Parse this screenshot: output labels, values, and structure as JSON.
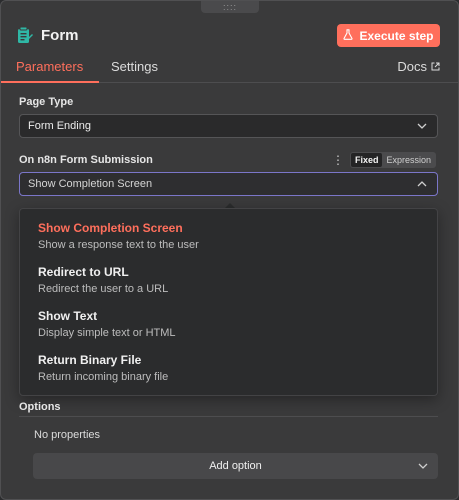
{
  "node": {
    "title": "Form",
    "icon": "form-icon",
    "execute_label": "Execute step",
    "execute_icon": "flask-icon",
    "accent_color": "#ff6f5c"
  },
  "tabs": [
    {
      "label": "Parameters",
      "active": true
    },
    {
      "label": "Settings",
      "active": false
    }
  ],
  "docs": {
    "label": "Docs",
    "icon": "external-link-icon"
  },
  "page_type": {
    "label": "Page Type",
    "value": "Form Ending"
  },
  "on_submission": {
    "label": "On n8n Form Submission",
    "value": "Show Completion Screen",
    "toggle": {
      "fixed": "Fixed",
      "expression": "Expression"
    }
  },
  "dropdown_options": [
    {
      "title": "Show Completion Screen",
      "desc": "Show a response text to the user",
      "selected": true
    },
    {
      "title": "Redirect to URL",
      "desc": "Redirect the user to a URL",
      "selected": false
    },
    {
      "title": "Show Text",
      "desc": "Display simple text or HTML",
      "selected": false
    },
    {
      "title": "Return Binary File",
      "desc": "Return incoming binary file",
      "selected": false
    }
  ],
  "options": {
    "label": "Options",
    "empty_text": "No properties",
    "add_label": "Add option"
  }
}
